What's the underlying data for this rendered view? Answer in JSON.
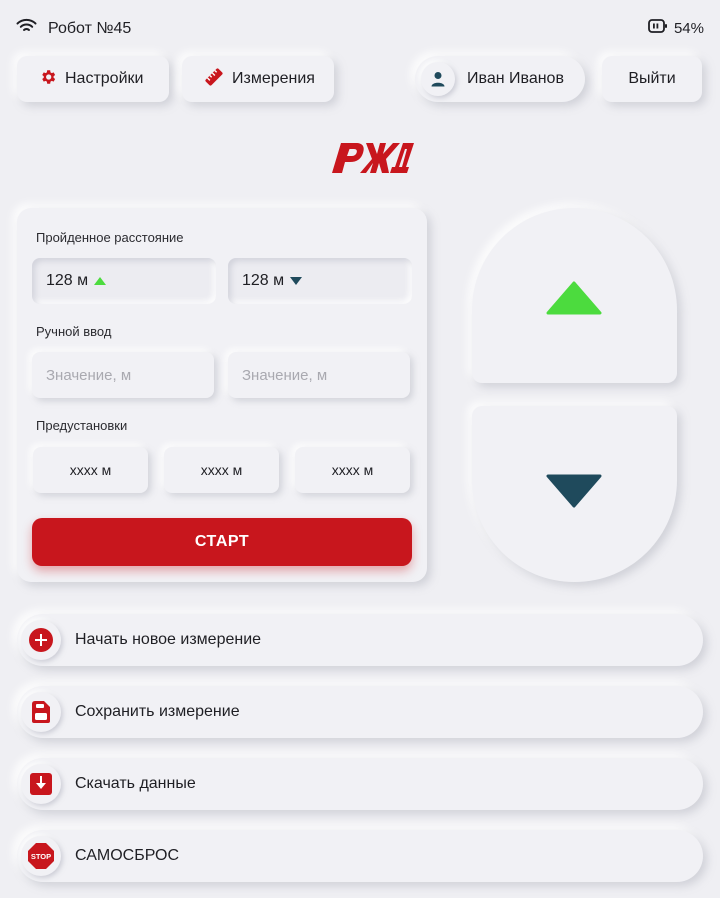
{
  "status": {
    "title": "Робот №45",
    "battery": "54%",
    "icons": [
      "wifi-icon",
      "battery-icon"
    ]
  },
  "toolbar": {
    "settings_label": "Настройки",
    "measure_label": "Измерения",
    "user_name": "Иван Иванов",
    "logout_label": "Выйти"
  },
  "brand": {
    "logo_text": "РЖД",
    "accent": "#c8161d"
  },
  "panel": {
    "distance_label": "Пройденное расстояние",
    "distance_forward": "128 м",
    "distance_backward": "128 м",
    "manual_label": "Ручной ввод",
    "manual_placeholder_1": "Значение, м",
    "manual_placeholder_2": "Значение, м",
    "presets_label": "Предустановки",
    "presets": [
      "хххх м",
      "хххх м",
      "хххх м"
    ],
    "start_label": "СТАРТ"
  },
  "joystick": {
    "up_color": "#4cdb3e",
    "down_color": "#1f4a5c"
  },
  "actions": [
    {
      "label": "Начать новое измерение",
      "icon": "plus-circle-icon"
    },
    {
      "label": "Сохранить измерение",
      "icon": "save-icon"
    },
    {
      "label": "Скачать данные",
      "icon": "download-icon"
    },
    {
      "label": "САМОСБРОС",
      "icon": "stop-sign-icon",
      "icon_text": "STOP"
    }
  ]
}
